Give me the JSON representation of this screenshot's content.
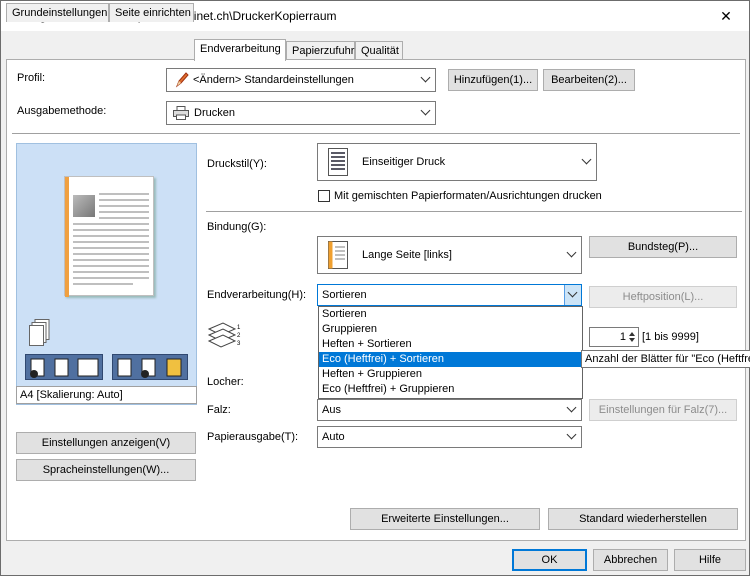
{
  "window": {
    "title": "Eigenschaften von \\\\print1.ad.kinet.ch\\DruckerKopierraum",
    "close_glyph": "✕"
  },
  "tabs": [
    {
      "label": "Grundeinstellungen"
    },
    {
      "label": "Seite einrichten"
    },
    {
      "label": "Endverarbeitung"
    },
    {
      "label": "Papierzufuhr"
    },
    {
      "label": "Qualität"
    }
  ],
  "profile": {
    "label": "Profil:",
    "value": "<Ändern> Standardeinstellungen",
    "add_button": "Hinzufügen(1)...",
    "edit_button": "Bearbeiten(2)..."
  },
  "output": {
    "label": "Ausgabemethode:",
    "value": "Drucken"
  },
  "preview": {
    "status": "A4 [Skalierung: Auto]"
  },
  "left_buttons": {
    "show_settings": "Einstellungen anzeigen(V)",
    "language_settings": "Spracheinstellungen(W)..."
  },
  "print_style": {
    "label": "Druckstil(Y):",
    "value": "Einseitiger Druck",
    "mixed_checkbox": "Mit gemischten Papierformaten/Ausrichtungen drucken"
  },
  "binding": {
    "label": "Bindung(G):",
    "value": "Lange Seite [links]",
    "gutter_button": "Bundsteg(P)..."
  },
  "finishing": {
    "label": "Endverarbeitung(H):",
    "value": "Sortieren",
    "staple_position_button": "Heftposition(L)...",
    "options": [
      "Sortieren",
      "Gruppieren",
      "Heften + Sortieren",
      "Eco (Heftfrei) + Sortieren",
      "Heften + Gruppieren",
      "Eco (Heftfrei) + Gruppieren"
    ],
    "selected_index": 3
  },
  "sheets": {
    "value": "1",
    "range": "[1 bis 9999]",
    "tooltip": "Anzahl der Blätter für \"Eco (Heftfrei)"
  },
  "hole_punch": {
    "label": "Locher:"
  },
  "fold": {
    "label": "Falz:",
    "value": "Aus",
    "settings_button": "Einstellungen für Falz(7)..."
  },
  "paper_output": {
    "label": "Papierausgabe(T):",
    "value": "Auto"
  },
  "bottom_buttons": {
    "advanced": "Erweiterte Einstellungen...",
    "restore": "Standard wiederherstellen"
  },
  "dialog_buttons": {
    "ok": "OK",
    "cancel": "Abbrechen",
    "help": "Hilfe"
  }
}
